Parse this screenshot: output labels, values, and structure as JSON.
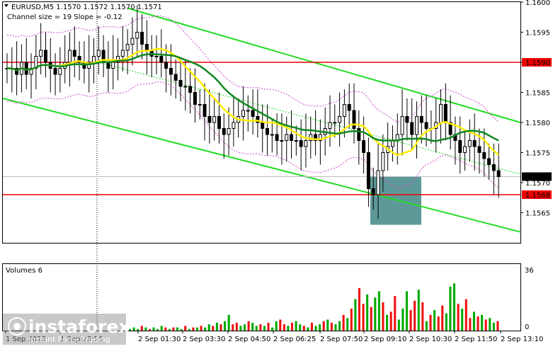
{
  "header": {
    "symbol_info": "EURUSD,M5  1.1570 1.1572 1.1570 1.1571",
    "channel_info": "Channel size = 19 Slope = -0.12"
  },
  "volume_panel": {
    "title": "Volumes 6",
    "scale_max": "36",
    "scale_min": "0"
  },
  "watermark": {
    "brand": "instaforex",
    "tagline": "Instant Forex Trading"
  },
  "colors": {
    "bull_candle": "#000000",
    "bear_candle": "#000000",
    "channel": "#22dd22",
    "ma_fast": "#ffee00",
    "ma_slow": "#118822",
    "bands": "#cc44cc",
    "level_line": "#ee0000",
    "highlight_box": "#5e9999",
    "vol_up": "#00aa00",
    "vol_down": "#ee1111"
  },
  "chart_data": {
    "type": "candlestick",
    "instrument": "EURUSD",
    "timeframe": "M5",
    "ylim": [
      1.156,
      1.16
    ],
    "y_ticks": [
      "1.1600",
      "1.1595",
      "1.1590",
      "1.1585",
      "1.1580",
      "1.1575",
      "1.1570",
      "1.1565"
    ],
    "x_tick_labels": [
      "1 Sep 2023",
      "1 Sep 23:55",
      "2 Sep 01:30",
      "2 Sep 03:30",
      "2 Sep 04:50",
      "2 Sep 06:25",
      "2 Sep 07:50",
      "2 Sep 09:10",
      "2 Sep 10:30",
      "2 Sep 11:50",
      "2 Sep 13:10"
    ],
    "price_labels": [
      {
        "text": "1.1590",
        "value": 1.159,
        "color": "#ee0000"
      },
      {
        "text": "1.1571",
        "value": 1.1571,
        "color": "#000000"
      },
      {
        "text": "1.1568",
        "value": 1.1568,
        "color": "#ee0000"
      }
    ],
    "levels": [
      1.159,
      1.1568
    ],
    "highlight_zone": {
      "price_from": 1.1563,
      "price_to": 1.1571
    },
    "candles_close": [
      1.1589,
      1.1589,
      1.1588,
      1.159,
      1.1588,
      1.1589,
      1.1591,
      1.1592,
      1.159,
      1.1589,
      1.1588,
      1.1589,
      1.159,
      1.1592,
      1.1591,
      1.159,
      1.1589,
      1.159,
      1.1591,
      1.1592,
      1.159,
      1.1589,
      1.159,
      1.1591,
      1.1592,
      1.1593,
      1.1594,
      1.1595,
      1.1593,
      1.1592,
      1.1591,
      1.1591,
      1.159,
      1.1589,
      1.1588,
      1.1587,
      1.1586,
      1.1586,
      1.1585,
      1.1583,
      1.1583,
      1.1581,
      1.158,
      1.1581,
      1.1579,
      1.1578,
      1.1579,
      1.158,
      1.1581,
      1.1582,
      1.1582,
      1.1581,
      1.158,
      1.1579,
      1.1578,
      1.1578,
      1.1577,
      1.1577,
      1.1578,
      1.1577,
      1.1577,
      1.1576,
      1.1577,
      1.1578,
      1.1577,
      1.1578,
      1.1579,
      1.158,
      1.158,
      1.1581,
      1.1583,
      1.1582,
      1.1579,
      1.1577,
      1.1575,
      1.1569,
      1.1568,
      1.1572,
      1.1575,
      1.1576,
      1.1577,
      1.1578,
      1.1581,
      1.158,
      1.1578,
      1.1581,
      1.158,
      1.1579,
      1.1579,
      1.158,
      1.1583,
      1.158,
      1.1578,
      1.1577,
      1.1575,
      1.1576,
      1.1577,
      1.1576,
      1.1575,
      1.1574,
      1.1573,
      1.1572,
      1.1571
    ],
    "volumes": [
      1,
      2,
      1,
      3,
      2,
      1,
      2,
      1,
      3,
      2,
      1,
      2,
      2,
      1,
      3,
      1,
      2,
      2,
      3,
      2,
      4,
      3,
      5,
      4,
      6,
      10,
      4,
      5,
      3,
      4,
      6,
      5,
      3,
      4,
      3,
      5,
      2,
      6,
      7,
      4,
      3,
      5,
      6,
      4,
      3,
      2,
      5,
      3,
      4,
      6,
      7,
      5,
      4,
      6,
      10,
      8,
      14,
      20,
      27,
      17,
      23,
      15,
      21,
      25,
      18,
      10,
      12,
      22,
      7,
      14,
      25,
      13,
      19,
      26,
      18,
      6,
      10,
      13,
      9,
      16,
      11,
      28,
      30,
      17,
      14,
      20,
      8,
      12,
      9,
      10,
      7,
      8,
      5,
      6
    ],
    "vol_colors": "gggrgrgggrgrggrgrgrggrgrggrrggrggrgrggrrgrggrgrggrgrggrgrgrrgrggrgrrgggrrgrgrgrrgggrgrrgrgrggrgrg"
  }
}
